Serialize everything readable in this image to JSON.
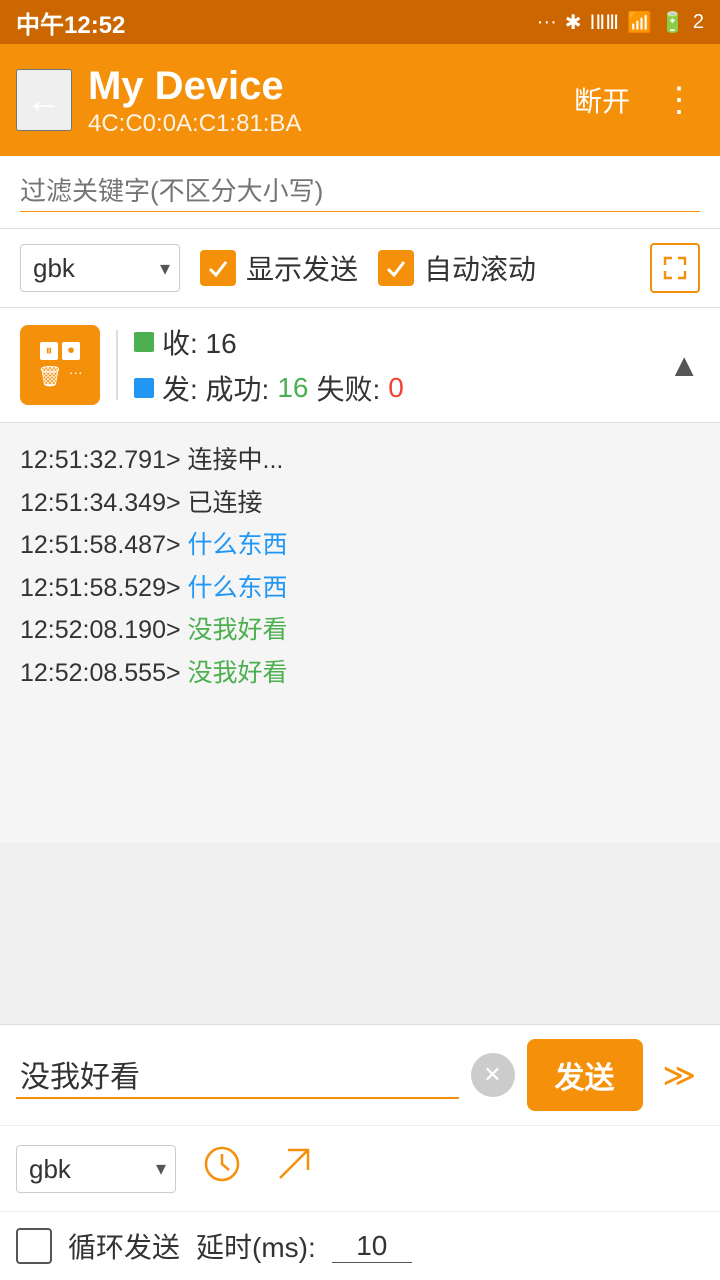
{
  "statusBar": {
    "time": "中午12:52",
    "battery": "2"
  },
  "header": {
    "title": "My Device",
    "subtitle": "4C:C0:0A:C1:81:BA",
    "disconnectLabel": "断开",
    "moreIcon": "⋮"
  },
  "filter": {
    "placeholder": "过滤关键字(不区分大小写)"
  },
  "controls": {
    "encoding": "gbk",
    "showSendLabel": "显示发送",
    "autoScrollLabel": "自动滚动"
  },
  "stats": {
    "recvLabel": "收: 16",
    "sendLabel": "发: 成功: 16 失败: 0",
    "successCount": "16",
    "failCount": "0"
  },
  "logs": [
    {
      "time": "12:51:32.791>",
      "msg": " 连接中...",
      "type": "default"
    },
    {
      "time": "12:51:34.349>",
      "msg": " 已连接",
      "type": "default"
    },
    {
      "time": "12:51:58.487>",
      "msg": " 什么东西",
      "type": "blue"
    },
    {
      "time": "12:51:58.529>",
      "msg": " 什么东西",
      "type": "blue"
    },
    {
      "time": "12:52:08.190>",
      "msg": " 没我好看",
      "type": "green"
    },
    {
      "time": "12:52:08.555>",
      "msg": " 没我好看",
      "type": "green"
    }
  ],
  "inputArea": {
    "currentMessage": "没我好看",
    "sendLabel": "发送"
  },
  "bottomTools": {
    "encoding": "gbk",
    "loopLabel": "循环发送",
    "delayLabel": "延时(ms):",
    "delayValue": "10"
  }
}
